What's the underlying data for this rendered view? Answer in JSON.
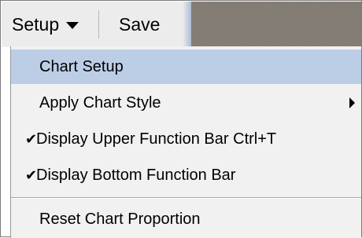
{
  "toolbar": {
    "setup_label": "Setup",
    "save_label": "Save"
  },
  "menu": {
    "items": [
      {
        "label": "Chart Setup",
        "selected": true
      },
      {
        "label": "Apply Chart Style",
        "has_submenu": true
      },
      {
        "label": "Display Upper Function Bar",
        "checked": true,
        "shortcut": "Ctrl+T"
      },
      {
        "label": "Display Bottom Function Bar",
        "checked": true
      },
      {
        "label": "Reset Chart Proportion"
      }
    ],
    "check_glyph": "✔"
  },
  "colors": {
    "selected_bg": "#bccde6",
    "menu_bg": "#f1f1f1",
    "toolbar_bg": "#ececec",
    "toolbar_right_bg": "#807a72"
  }
}
